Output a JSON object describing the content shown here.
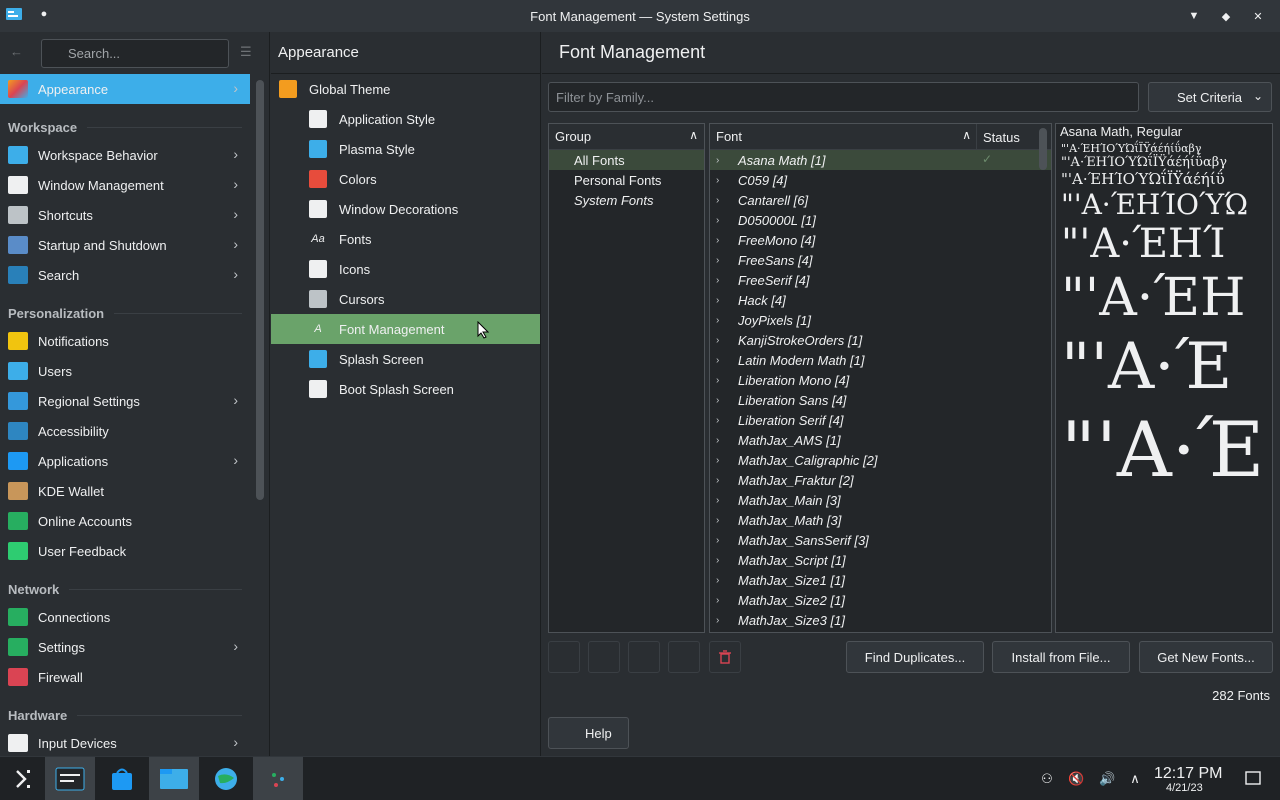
{
  "window": {
    "title": "Font Management — System Settings"
  },
  "sidebar": {
    "search_placeholder": "Search...",
    "top_item": {
      "label": "Appearance"
    },
    "sections": [
      {
        "title": "Workspace",
        "items": [
          {
            "label": "Workspace Behavior",
            "chevron": true,
            "color": "#3daee9"
          },
          {
            "label": "Window Management",
            "chevron": true,
            "color": "#eff0f1"
          },
          {
            "label": "Shortcuts",
            "chevron": true,
            "color": "#bdc3c7"
          },
          {
            "label": "Startup and Shutdown",
            "chevron": true,
            "color": "#5a8cc8"
          },
          {
            "label": "Search",
            "chevron": true,
            "color": "#2980b9"
          }
        ]
      },
      {
        "title": "Personalization",
        "items": [
          {
            "label": "Notifications",
            "chevron": false,
            "color": "#f1c40f"
          },
          {
            "label": "Users",
            "chevron": false,
            "color": "#3daee9"
          },
          {
            "label": "Regional Settings",
            "chevron": true,
            "color": "#3498db"
          },
          {
            "label": "Accessibility",
            "chevron": false,
            "color": "#2e86c1"
          },
          {
            "label": "Applications",
            "chevron": true,
            "color": "#1d99f3"
          },
          {
            "label": "KDE Wallet",
            "chevron": false,
            "color": "#c8965a"
          },
          {
            "label": "Online Accounts",
            "chevron": false,
            "color": "#27ae60"
          },
          {
            "label": "User Feedback",
            "chevron": false,
            "color": "#2ecc71"
          }
        ]
      },
      {
        "title": "Network",
        "items": [
          {
            "label": "Connections",
            "chevron": false,
            "color": "#27ae60"
          },
          {
            "label": "Settings",
            "chevron": true,
            "color": "#27ae60"
          },
          {
            "label": "Firewall",
            "chevron": false,
            "color": "#da4453"
          }
        ]
      },
      {
        "title": "Hardware",
        "items": [
          {
            "label": "Input Devices",
            "chevron": true,
            "color": "#eff0f1"
          }
        ]
      }
    ]
  },
  "middle": {
    "header": "Appearance",
    "items": [
      {
        "label": "Global Theme",
        "level": 0,
        "color": "#f39c1f"
      },
      {
        "label": "Application Style",
        "level": 1,
        "color": "#eff0f1"
      },
      {
        "label": "Plasma Style",
        "level": 1,
        "color": "#3daee9"
      },
      {
        "label": "Colors",
        "level": 1,
        "color": "#e74c3c"
      },
      {
        "label": "Window Decorations",
        "level": 1,
        "color": "#eff0f1"
      },
      {
        "label": "Fonts",
        "level": 1,
        "color": "#31363b",
        "glyph": "Aa"
      },
      {
        "label": "Icons",
        "level": 1,
        "color": "#eff0f1"
      },
      {
        "label": "Cursors",
        "level": 1,
        "color": "#bdc3c7"
      },
      {
        "label": "Font Management",
        "level": 1,
        "color": "#6aa36a",
        "glyph": "A",
        "active": true
      },
      {
        "label": "Splash Screen",
        "level": 1,
        "color": "#3daee9"
      },
      {
        "label": "Boot Splash Screen",
        "level": 1,
        "color": "#eff0f1"
      }
    ]
  },
  "main": {
    "header": "Font Management",
    "filter_placeholder": "Filter by Family...",
    "criteria_label": "Set Criteria",
    "group_header": "Group",
    "groups": [
      {
        "label": "All Fonts",
        "active": true,
        "italic": false
      },
      {
        "label": "Personal Fonts",
        "active": false,
        "italic": false
      },
      {
        "label": "System Fonts",
        "active": false,
        "italic": true
      }
    ],
    "font_header": "Font",
    "status_header": "Status",
    "fonts": [
      "Asana Math [1]",
      "C059 [4]",
      "Cantarell [6]",
      "D050000L [1]",
      "FreeMono [4]",
      "FreeSans [4]",
      "FreeSerif [4]",
      "Hack [4]",
      "JoyPixels [1]",
      "KanjiStrokeOrders [1]",
      "Latin Modern Math [1]",
      "Liberation Mono [4]",
      "Liberation Sans [4]",
      "Liberation Serif [4]",
      "MathJax_AMS [1]",
      "MathJax_Caligraphic [2]",
      "MathJax_Fraktur [2]",
      "MathJax_Main [3]",
      "MathJax_Math [3]",
      "MathJax_SansSerif [3]",
      "MathJax_Script [1]",
      "MathJax_Size1 [1]",
      "MathJax_Size2 [1]",
      "MathJax_Size3 [1]"
    ],
    "preview_title": "Asana Math, Regular",
    "preview_lines": [
      {
        "text": "\"'A·ΈΗΊΟΎΏΐΪΫάέήίΰαβγ",
        "size": 11
      },
      {
        "text": "\"'A·ΈΗΊΟΎΏΐΪΫάέήίΰαβγ",
        "size": 13
      },
      {
        "text": "\"'A·ΈΗΊΟΎΏΐΪΫάέήίΰ",
        "size": 15
      },
      {
        "text": "\"'A·ΈΗΊΟΎΏ",
        "size": 28
      },
      {
        "text": "\"'A·ΈΗΊ",
        "size": 40
      },
      {
        "text": "\"'A·ΈΗ",
        "size": 52
      },
      {
        "text": "\"'A·Έ",
        "size": 64
      },
      {
        "text": "\"'A·Έ",
        "size": 76
      }
    ],
    "buttons": {
      "find_duplicates": "Find Duplicates...",
      "install": "Install from File...",
      "get_new": "Get New Fonts..."
    },
    "count": "282 Fonts",
    "help": "Help"
  },
  "taskbar": {
    "time": "12:17 PM",
    "date": "4/21/23"
  }
}
